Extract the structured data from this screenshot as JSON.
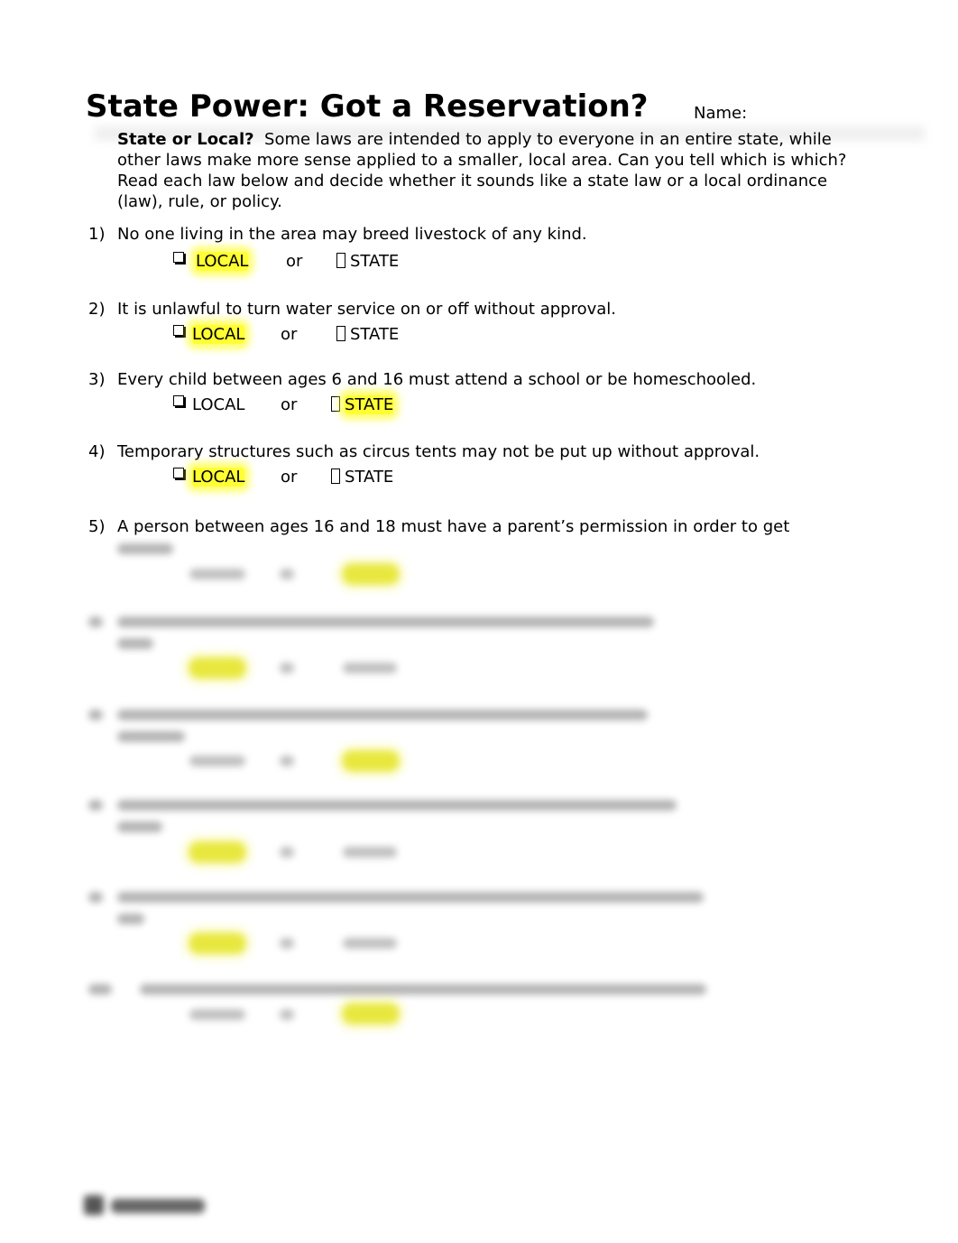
{
  "document": {
    "title": "State Power: Got a Reservation?",
    "name_label": "Name:",
    "intro": {
      "heading": "State or Local?",
      "text": "Some laws are intended to apply to everyone in an entire state, while other laws make more sense applied to a smaller, local area. Can you tell which is which? Read each law below and decide whether it sounds like a state law or a local ordinance (law), rule, or policy."
    },
    "choice_labels": {
      "local": "LOCAL",
      "or": "or",
      "state": "STATE"
    },
    "highlight_color": "#ffff33",
    "questions": [
      {
        "number": "1)",
        "text": "No one living in the area may breed livestock of any kind.",
        "answer": "LOCAL"
      },
      {
        "number": "2)",
        "text": "It is unlawful to turn water service on or off without approval.",
        "answer": "LOCAL"
      },
      {
        "number": "3)",
        "text": "Every child between ages 6 and 16 must attend a school or be homeschooled.",
        "answer": "STATE"
      },
      {
        "number": "4)",
        "text": "Temporary structures such as circus tents may not be put up without approval.",
        "answer": "LOCAL"
      },
      {
        "number": "5)",
        "text": "A person between ages 16 and 18 must have a parent’s permission in order to get",
        "answer": "STATE",
        "blurred_remainder": true
      }
    ],
    "blurred_questions": [
      {
        "number": "6)",
        "answer": "LOCAL"
      },
      {
        "number": "7)",
        "answer": "STATE"
      },
      {
        "number": "8)",
        "answer": "LOCAL"
      },
      {
        "number": "9)",
        "answer": "LOCAL"
      },
      {
        "number": "10)",
        "answer": "STATE"
      }
    ],
    "content_obscured": true
  }
}
